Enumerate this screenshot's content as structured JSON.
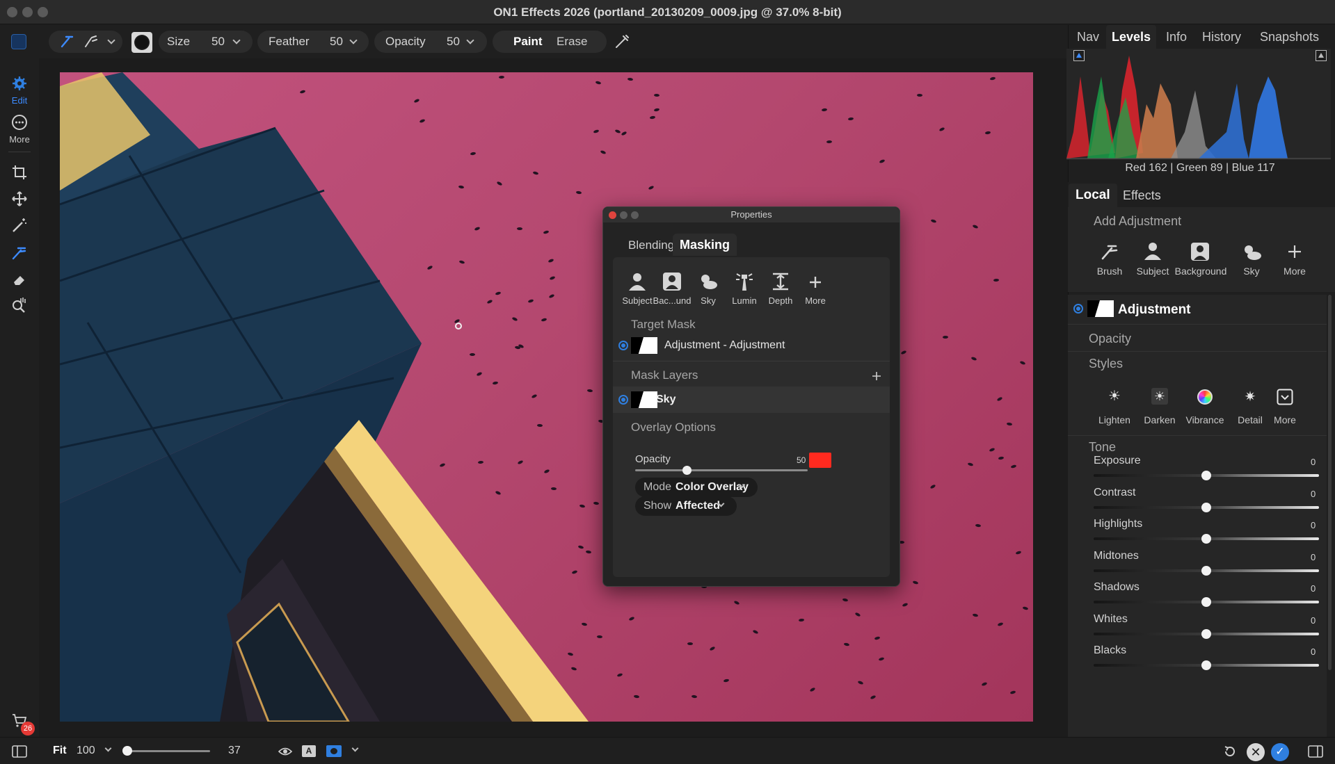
{
  "window": {
    "title": "ON1 Effects 2026 (portland_20130209_0009.jpg @ 37.0% 8-bit)"
  },
  "toolbar": {
    "size_label": "Size",
    "size_value": "50",
    "feather_label": "Feather",
    "feather_value": "50",
    "opacity_label": "Opacity",
    "opacity_value": "50",
    "paint_label": "Paint",
    "erase_label": "Erase"
  },
  "left_rail": {
    "edit_label": "Edit",
    "more_label": "More",
    "cart_badge": "26"
  },
  "bottom_bar": {
    "fit_label": "Fit",
    "zoom_value": "100",
    "zoom_slider_value": "37"
  },
  "right_panel": {
    "tabs": [
      "Nav",
      "Levels",
      "Info",
      "History",
      "Snapshots"
    ],
    "active_tab": "Levels",
    "readout": "Red 162 | Green  89  | Blue 117",
    "mode_tabs": [
      "Local",
      "Effects"
    ],
    "add_adjustment_label": "Add Adjustment",
    "add_tools": [
      "Brush",
      "Subject",
      "Background",
      "Sky",
      "More"
    ],
    "layer_title": "Adjustment",
    "opacity_label": "Opacity",
    "styles_label": "Styles",
    "style_buttons": [
      "Lighten",
      "Darken",
      "Vibrance",
      "Detail",
      "More"
    ],
    "tone_label": "Tone",
    "tone_sliders": [
      {
        "label": "Exposure",
        "value": "0",
        "position": 0.5
      },
      {
        "label": "Contrast",
        "value": "0",
        "position": 0.5
      },
      {
        "label": "Highlights",
        "value": "0",
        "position": 0.5
      },
      {
        "label": "Midtones",
        "value": "0",
        "position": 0.5
      },
      {
        "label": "Shadows",
        "value": "0",
        "position": 0.5
      },
      {
        "label": "Whites",
        "value": "0",
        "position": 0.5
      },
      {
        "label": "Blacks",
        "value": "0",
        "position": 0.5
      }
    ]
  },
  "properties": {
    "title": "Properties",
    "tabs": [
      "Blending",
      "Masking"
    ],
    "active_tab": "Masking",
    "mask_tools": [
      "Subject",
      "Bac...und",
      "Sky",
      "Lumin",
      "Depth",
      "More"
    ],
    "target_mask_label": "Target Mask",
    "target_mask_item": "Adjustment - Adjustment",
    "mask_layers_label": "Mask Layers",
    "mask_layer_item": "Sky",
    "overlay_options_label": "Overlay Options",
    "overlay_opacity_label": "Opacity",
    "overlay_opacity_value": "50",
    "overlay_opacity_position": 0.3,
    "overlay_color": "#ff2a1f",
    "mode_label": "Mode",
    "mode_value": "Color Overlay",
    "show_label": "Show",
    "show_value": "Affected"
  },
  "colors": {
    "accent": "#2f7fe0",
    "sky_top": "#c2527d",
    "sky_bottom": "#a3355b",
    "badge": "#e53935"
  }
}
